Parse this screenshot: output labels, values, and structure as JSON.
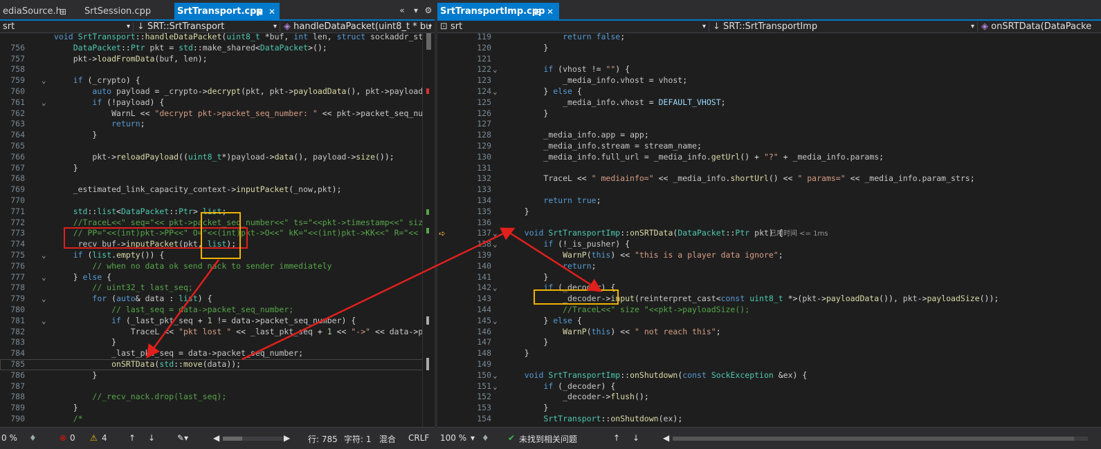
{
  "left": {
    "tabs": [
      {
        "label": "ediaSource.h",
        "pin": "⊞"
      },
      {
        "label": "SrtSession.cpp"
      },
      {
        "label": "SrtTransport.cpp",
        "pin": "⊞",
        "close": "✕"
      }
    ],
    "tab_buttons": [
      "«",
      "▾",
      "⚙"
    ],
    "nav": {
      "project": "srt",
      "class": "SRT::SrtTransport",
      "method": "handleDataPacket(uint8_t * bu"
    },
    "lines": [
      {
        "n": "",
        "code": "void SrtTransport::handleDataPacket(uint8_t *buf, int len, struct sockaddr_st"
      },
      {
        "n": "756",
        "code": "    DataPacket::Ptr pkt = std::make_shared<DataPacket>();"
      },
      {
        "n": "757",
        "code": "    pkt->loadFromData(buf, len);"
      },
      {
        "n": "758",
        "code": ""
      },
      {
        "n": "759",
        "code": "    if (_crypto) {"
      },
      {
        "n": "760",
        "code": "        auto payload = _crypto->decrypt(pkt, pkt->payloadData(), pkt->payloadS"
      },
      {
        "n": "761",
        "code": "        if (!payload) {"
      },
      {
        "n": "762",
        "code": "            WarnL << \"decrypt pkt->packet_seq_number: \" << pkt->packet_seq_nu"
      },
      {
        "n": "763",
        "code": "            return;"
      },
      {
        "n": "764",
        "code": "        }"
      },
      {
        "n": "765",
        "code": ""
      },
      {
        "n": "766",
        "code": "        pkt->reloadPayload((uint8_t*)payload->data(), payload->size());"
      },
      {
        "n": "767",
        "code": "    }"
      },
      {
        "n": "768",
        "code": ""
      },
      {
        "n": "769",
        "code": "    _estimated_link_capacity_context->inputPacket(_now,pkt);"
      },
      {
        "n": "770",
        "code": ""
      },
      {
        "n": "771",
        "code": "    std::list<DataPacket::Ptr> list;"
      },
      {
        "n": "772",
        "code": "    //TraceL<<\" seq=\"<< pkt->packet_seq_number<<\" ts=\"<<pkt->timestamp<<\" siz"
      },
      {
        "n": "773",
        "code": "    // PP=\"<<(int)pkt->PP<<\" O=\"<<(int)pkt->O<<\" kK=\"<<(int)pkt->KK<<\" R=\"<<"
      },
      {
        "n": "774",
        "code": "    _recv_buf->inputPacket(pkt, list);"
      },
      {
        "n": "775",
        "code": "    if (list.empty()) {"
      },
      {
        "n": "776",
        "code": "        // when no data ok send nack to sender immediately"
      },
      {
        "n": "777",
        "code": "    } else {"
      },
      {
        "n": "778",
        "code": "        // uint32_t last_seq;"
      },
      {
        "n": "779",
        "code": "        for (auto& data : list) {"
      },
      {
        "n": "780",
        "code": "            // last_seq = data->packet_seq_number;"
      },
      {
        "n": "781",
        "code": "            if (_last_pkt_seq + 1 != data->packet_seq_number) {"
      },
      {
        "n": "782",
        "code": "                TraceL << \"pkt lost \" << _last_pkt_seq + 1 << \"->\" << data->p"
      },
      {
        "n": "783",
        "code": "            }"
      },
      {
        "n": "784",
        "code": "            _last_pkt_seq = data->packet_seq_number;"
      },
      {
        "n": "785",
        "code": "            onSRTData(std::move(data));"
      },
      {
        "n": "786",
        "code": "        }"
      },
      {
        "n": "787",
        "code": ""
      },
      {
        "n": "788",
        "code": "        //_recv_nack.drop(last_seq);"
      },
      {
        "n": "789",
        "code": "    }"
      },
      {
        "n": "790",
        "code": "    /*"
      }
    ],
    "status": {
      "zoom": "0 %",
      "errors": "0",
      "warnings": "4",
      "row": "行: 785",
      "col": "字符: 1",
      "mode": "混合",
      "eol": "CRLF"
    }
  },
  "right": {
    "tabs": [
      {
        "label": "SrtTransportImp.cpp",
        "pin": "⊞",
        "close": "✕"
      }
    ],
    "nav": {
      "project": "srt",
      "class": "SRT::SrtTransportImp",
      "method": "onSRTData(DataPacke"
    },
    "lines": [
      {
        "n": "119",
        "code": "            return false;"
      },
      {
        "n": "120",
        "code": "        }"
      },
      {
        "n": "121",
        "code": ""
      },
      {
        "n": "122",
        "code": "        if (vhost != \"\") {"
      },
      {
        "n": "123",
        "code": "            _media_info.vhost = vhost;"
      },
      {
        "n": "124",
        "code": "        } else {"
      },
      {
        "n": "125",
        "code": "            _media_info.vhost = DEFAULT_VHOST;"
      },
      {
        "n": "126",
        "code": "        }"
      },
      {
        "n": "127",
        "code": ""
      },
      {
        "n": "128",
        "code": "        _media_info.app = app;"
      },
      {
        "n": "129",
        "code": "        _media_info.stream = stream_name;"
      },
      {
        "n": "130",
        "code": "        _media_info.full_url = _media_info.getUrl() + \"?\" + _media_info.params;"
      },
      {
        "n": "131",
        "code": ""
      },
      {
        "n": "132",
        "code": "        TraceL << \" mediainfo=\" << _media_info.shortUrl() << \" params=\" << _media_info.param_strs;"
      },
      {
        "n": "133",
        "code": ""
      },
      {
        "n": "134",
        "code": "        return true;"
      },
      {
        "n": "135",
        "code": "    }"
      },
      {
        "n": "136",
        "code": ""
      },
      {
        "n": "137",
        "code": "    void SrtTransportImp::onSRTData(DataPacket::Ptr pkt) {"
      },
      {
        "n": "138",
        "code": "        if (!_is_pusher) {"
      },
      {
        "n": "139",
        "code": "            WarnP(this) << \"this is a player data ignore\";"
      },
      {
        "n": "140",
        "code": "            return;"
      },
      {
        "n": "141",
        "code": "        }"
      },
      {
        "n": "142",
        "code": "        if (_decoder) {"
      },
      {
        "n": "143",
        "code": "            _decoder->input(reinterpret_cast<const uint8_t *>(pkt->payloadData()), pkt->payloadSize());"
      },
      {
        "n": "144",
        "code": "            //TraceL<<\" size \"<<pkt->payloadSize();"
      },
      {
        "n": "145",
        "code": "        } else {"
      },
      {
        "n": "146",
        "code": "            WarnP(this) << \" not reach this\";"
      },
      {
        "n": "147",
        "code": "        }"
      },
      {
        "n": "148",
        "code": "    }"
      },
      {
        "n": "149",
        "code": ""
      },
      {
        "n": "150",
        "code": "    void SrtTransportImp::onShutdown(const SockException &ex) {"
      },
      {
        "n": "151",
        "code": "        if (_decoder) {"
      },
      {
        "n": "152",
        "code": "            _decoder->flush();"
      },
      {
        "n": "153",
        "code": "        }"
      },
      {
        "n": "154",
        "code": "        SrtTransport::onShutdown(ex);"
      }
    ],
    "elapsed_hint": "已用时间 <= 1ms",
    "status": {
      "zoom": "100 %",
      "issues": "未找到相关问题"
    }
  },
  "colors": {
    "accent": "#007acc",
    "red_box": "#e0201c",
    "yellow_box": "#f0b400"
  }
}
